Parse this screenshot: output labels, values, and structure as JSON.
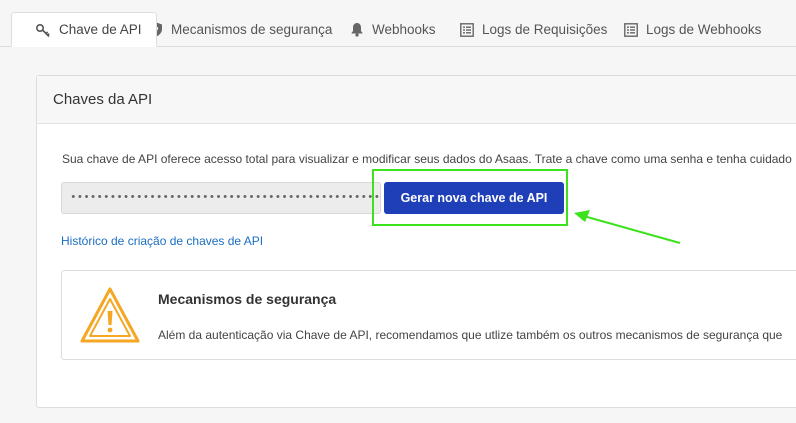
{
  "tabs": [
    {
      "label": "Chave de API",
      "icon": "key-icon",
      "active": true
    },
    {
      "label": "Mecanismos de segurança",
      "icon": "shield-icon",
      "active": false
    },
    {
      "label": "Webhooks",
      "icon": "bell-icon",
      "active": false
    },
    {
      "label": "Logs de Requisições",
      "icon": "list-icon",
      "active": false
    },
    {
      "label": "Logs de Webhooks",
      "icon": "list-icon",
      "active": false
    }
  ],
  "panel": {
    "title": "Chaves da API",
    "description": "Sua chave de API oferece acesso total para visualizar e modificar seus dados do Asaas. Trate a chave como uma senha e tenha cuidado",
    "api_key_masked": "••••••••••••••••••••••••••••••••••••••••••••••••••••••••••••",
    "generate_button": "Gerar nova chave de API",
    "history_link": "Histórico de criação de chaves de API"
  },
  "security_card": {
    "icon": "warning-icon",
    "title": "Mecanismos de segurança",
    "text": "Além da autenticação via Chave de API, recomendamos que utlize também os outros mecanismos de segurança que"
  },
  "colors": {
    "primary_button": "#1f3fb8",
    "link": "#1a6ec2",
    "warning": "#f5a623",
    "annotation": "#3ce21d"
  }
}
